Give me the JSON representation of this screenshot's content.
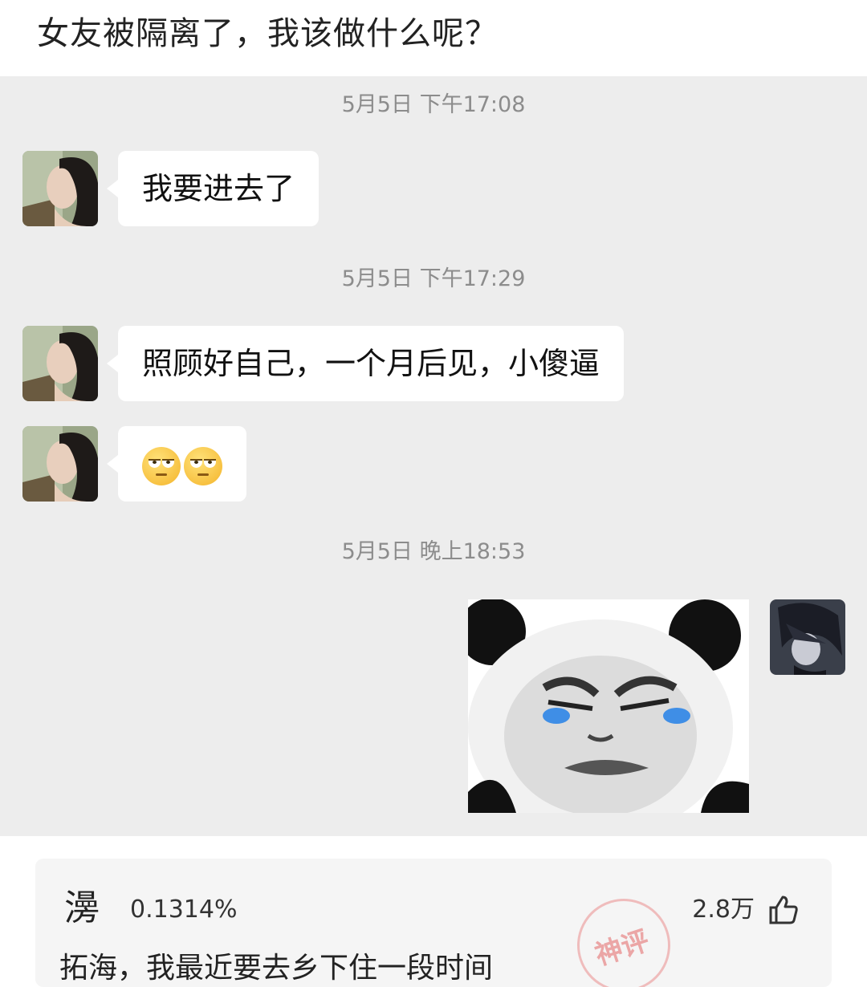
{
  "post": {
    "title": "女友被隔离了，我该做什么呢？"
  },
  "chat": {
    "timestamps": [
      "5月5日 下午17:08",
      "5月5日 下午17:29",
      "5月5日 晚上18:53"
    ],
    "messages": [
      {
        "sender": "girlfriend",
        "text": "我要进去了"
      },
      {
        "sender": "girlfriend",
        "text": "照顾好自己，一个月后见，小傻逼"
      },
      {
        "sender": "girlfriend",
        "emoji": [
          "rolling-eyes-face",
          "rolling-eyes-face"
        ]
      },
      {
        "sender": "me",
        "sticker": "panda-crying-face"
      }
    ]
  },
  "comment": {
    "user": "0.1314%",
    "likes": "2.8万",
    "text": "拓海，我最近要去乡下住一段时间",
    "badge": "神评",
    "avatar_glyph": "澷"
  },
  "colors": {
    "chat_bg": "#ededed",
    "bubble": "#ffffff",
    "timestamp": "#8c8c8c"
  }
}
